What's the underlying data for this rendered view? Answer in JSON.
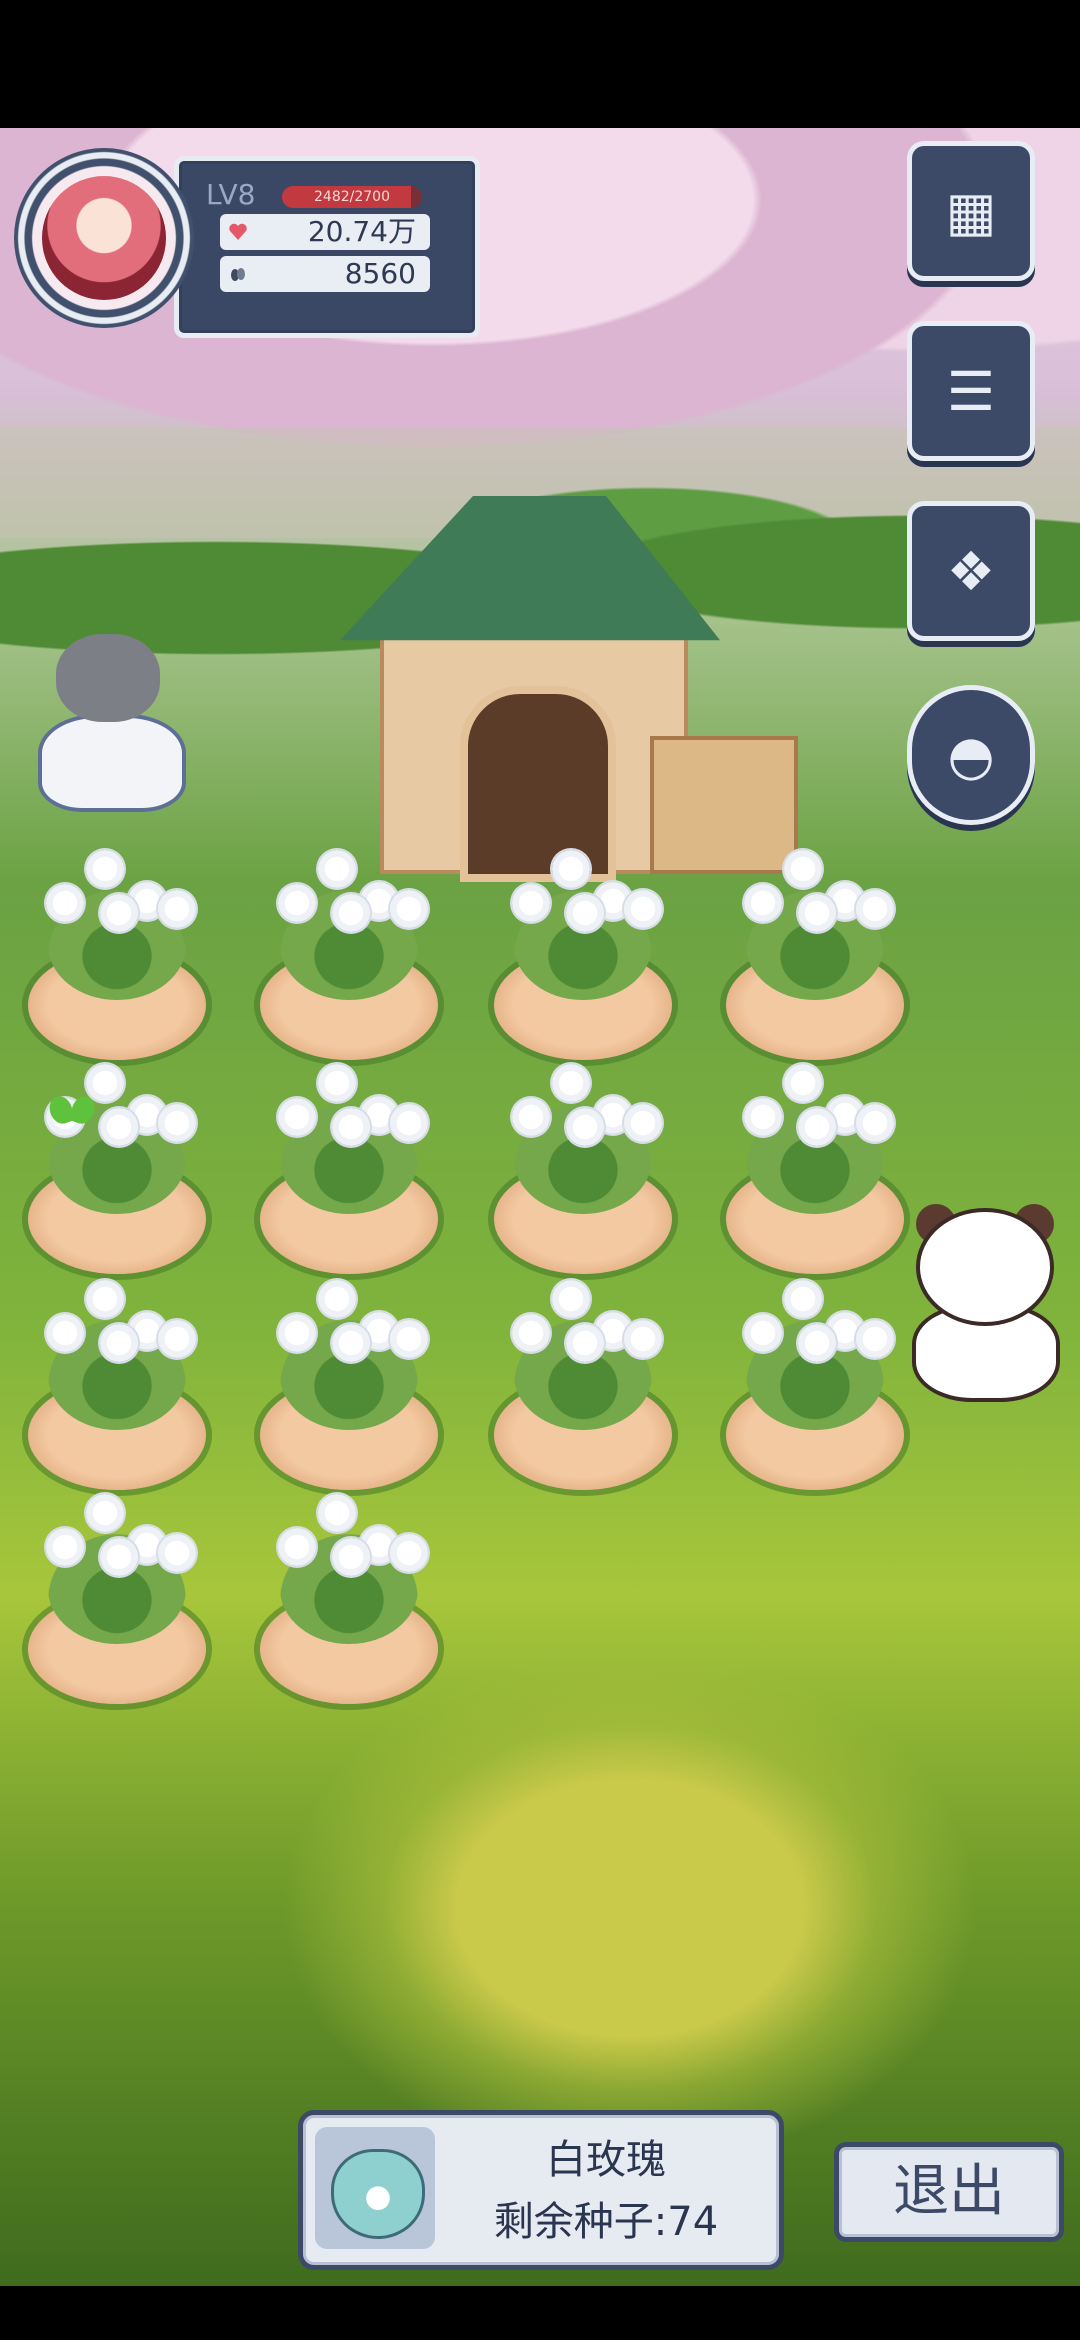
{
  "player": {
    "level_label": "LV8",
    "xp_text": "2482/2700",
    "xp_fraction": 0.919,
    "hearts_value": "20.74万",
    "seeds_value": "8560"
  },
  "side_buttons": [
    {
      "icon": "calendar-icon"
    },
    {
      "icon": "clipboard-tasks-icon"
    },
    {
      "icon": "gift-box-icon"
    },
    {
      "icon": "hot-air-balloon-icon"
    }
  ],
  "garden": {
    "plots_count": 14,
    "plant": "white-rose"
  },
  "seed_panel": {
    "seed_name": "白玫瑰",
    "remaining_text": "剩余种子:74"
  },
  "exit_label": "退出",
  "colors": {
    "panel_dark": "#3a4866",
    "panel_light": "#e6eaf1",
    "xp_red": "#c23a3f",
    "grass": "#7fb33c"
  }
}
